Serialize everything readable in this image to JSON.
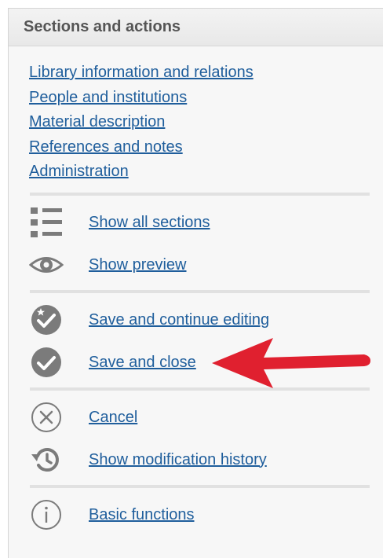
{
  "panel": {
    "title": "Sections and actions"
  },
  "section_links": [
    "Library information and relations",
    "People and institutions",
    "Material description",
    "References and notes",
    "Administration"
  ],
  "actions": {
    "show_all_sections": "Show all sections",
    "show_preview": "Show preview",
    "save_continue": "Save and continue editing",
    "save_close": "Save and close",
    "cancel": "Cancel",
    "modification_history": "Show modification history",
    "basic_functions": "Basic functions"
  },
  "icons": {
    "show_all_sections": "list-icon",
    "show_preview": "eye-icon",
    "save_continue": "check-star-icon",
    "save_close": "check-circle-icon",
    "cancel": "x-circle-icon",
    "modification_history": "history-icon",
    "basic_functions": "info-icon",
    "annotation": "red-arrow-icon"
  },
  "colors": {
    "link": "#1f5e9c",
    "icon_gray": "#7b7b7b",
    "arrow_red": "#e0202f",
    "header_bg": "#ececec",
    "panel_bg": "#f7f7f7"
  }
}
